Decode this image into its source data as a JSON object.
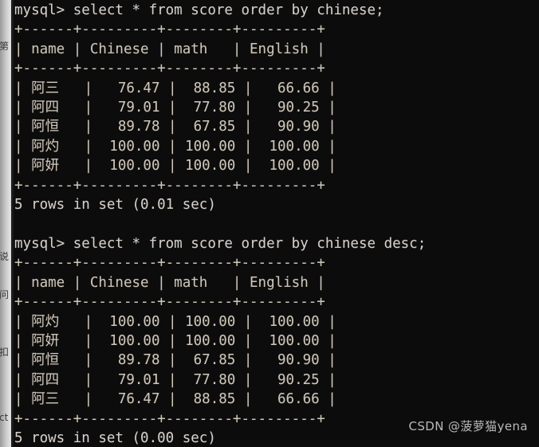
{
  "window": {
    "kind": "mysql-terminal",
    "background_color": "#0c0c0c",
    "foreground_color": "#d6d0c8",
    "background_window_color": "#c9c9c9"
  },
  "background_window_fragments": [
    {
      "text": "第"
    },
    {
      "text": "说"
    },
    {
      "text": "问"
    },
    {
      "text": "扣"
    },
    {
      "text": "ct"
    }
  ],
  "prompt": "mysql>",
  "sessions": [
    {
      "command_line": "mysql> select * from score order by chinese;",
      "command": "select * from score order by chinese;",
      "table": {
        "top_rule": "+------+---------+--------+---------+",
        "header_line": "| name | Chinese | math   | English |",
        "mid_rule": "+------+---------+--------+---------+",
        "bottom_rule": "+------+---------+--------+---------+",
        "columns": [
          "name",
          "Chinese",
          "math",
          "English"
        ],
        "rows": [
          {
            "cells": [
              "阿三",
              "76.47",
              "88.85",
              "66.66"
            ],
            "line": "| 阿三   |   76.47 |  88.85 |   66.66 |"
          },
          {
            "cells": [
              "阿四",
              "79.01",
              "77.80",
              "90.25"
            ],
            "line": "| 阿四   |   79.01 |  77.80 |   90.25 |"
          },
          {
            "cells": [
              "阿恒",
              "89.78",
              "67.85",
              "90.90"
            ],
            "line": "| 阿恒   |   89.78 |  67.85 |   90.90 |"
          },
          {
            "cells": [
              "阿灼",
              "100.00",
              "100.00",
              "100.00"
            ],
            "line": "| 阿灼   |  100.00 | 100.00 |  100.00 |"
          },
          {
            "cells": [
              "阿妍",
              "100.00",
              "100.00",
              "100.00"
            ],
            "line": "| 阿妍   |  100.00 | 100.00 |  100.00 |"
          }
        ]
      },
      "status": "5 rows in set (0.01 sec)",
      "row_count": 5,
      "elapsed": "0.01 sec"
    },
    {
      "command_line": "mysql> select * from score order by chinese desc;",
      "command": "select * from score order by chinese desc;",
      "table": {
        "top_rule": "+------+---------+--------+---------+",
        "header_line": "| name | Chinese | math   | English |",
        "mid_rule": "+------+---------+--------+---------+",
        "bottom_rule": "+------+---------+--------+---------+",
        "columns": [
          "name",
          "Chinese",
          "math",
          "English"
        ],
        "rows": [
          {
            "cells": [
              "阿灼",
              "100.00",
              "100.00",
              "100.00"
            ],
            "line": "| 阿灼   |  100.00 | 100.00 |  100.00 |"
          },
          {
            "cells": [
              "阿妍",
              "100.00",
              "100.00",
              "100.00"
            ],
            "line": "| 阿妍   |  100.00 | 100.00 |  100.00 |"
          },
          {
            "cells": [
              "阿恒",
              "89.78",
              "67.85",
              "90.90"
            ],
            "line": "| 阿恒   |   89.78 |  67.85 |   90.90 |"
          },
          {
            "cells": [
              "阿四",
              "79.01",
              "77.80",
              "90.25"
            ],
            "line": "| 阿四   |   79.01 |  77.80 |   90.25 |"
          },
          {
            "cells": [
              "阿三",
              "76.47",
              "88.85",
              "66.66"
            ],
            "line": "| 阿三   |   76.47 |  88.85 |   66.66 |"
          }
        ]
      },
      "status": "5 rows in set (0.00 sec)",
      "row_count": 5,
      "elapsed": "0.00 sec"
    }
  ],
  "watermark": "CSDN @菠萝猫yena"
}
